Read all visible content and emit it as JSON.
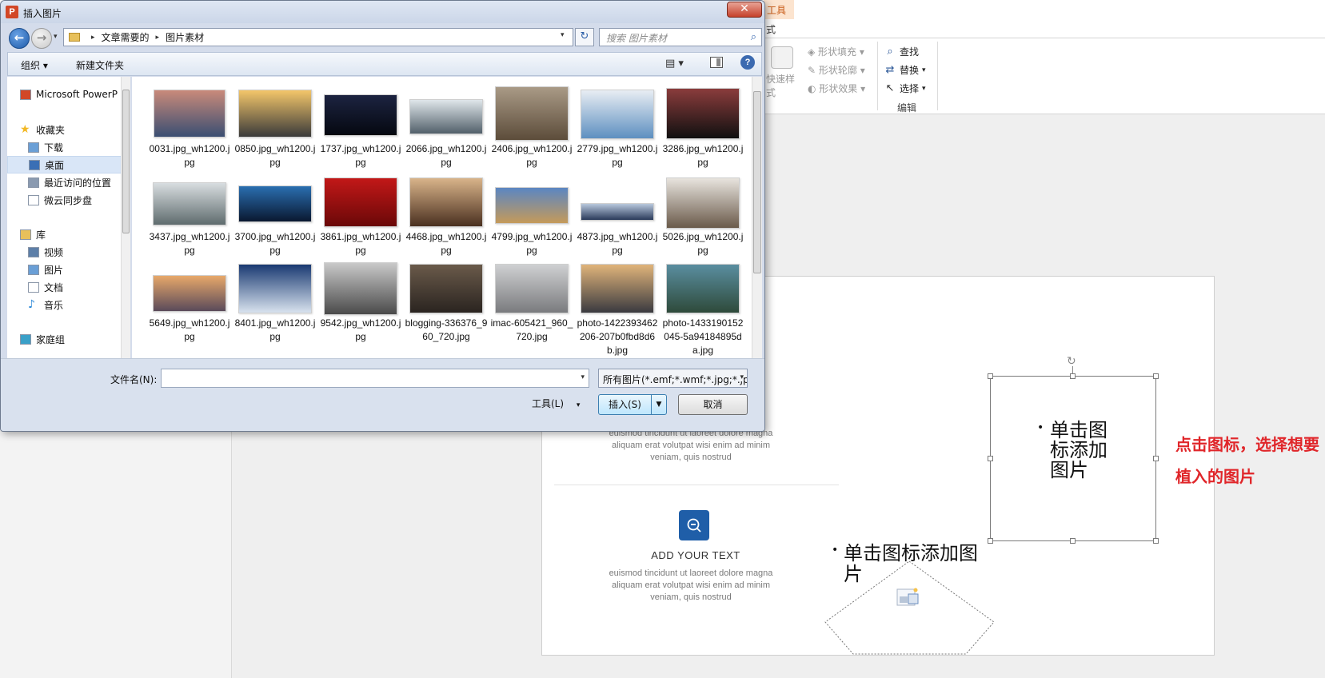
{
  "dialog": {
    "title": "插入图片",
    "close_glyph": "✕",
    "nav": {
      "back_glyph": "←",
      "forward_glyph": "→",
      "recent_glyph": "▾"
    },
    "address": {
      "crumbs": [
        "文章需要的",
        "图片素材"
      ],
      "separator": "▸",
      "dropdown_glyph": "▾"
    },
    "refresh_glyph": "↻",
    "search": {
      "placeholder": "搜索 图片素材",
      "icon": "search-icon"
    },
    "command_bar": {
      "organize": "组织 ▾",
      "new_folder": "新建文件夹",
      "view_glyph": "▤ ▾",
      "help": "?"
    },
    "nav_pane": {
      "items": [
        {
          "label": "Microsoft PowerP",
          "icon": "powerpoint-icon"
        },
        {
          "label": "收藏夹",
          "icon": "star-icon"
        },
        {
          "label": "下载",
          "icon": "download-icon"
        },
        {
          "label": "桌面",
          "icon": "desktop-icon",
          "selected": true
        },
        {
          "label": "最近访问的位置",
          "icon": "recent-places-icon"
        },
        {
          "label": "微云同步盘",
          "icon": "cloud-drive-icon"
        },
        {
          "label": "库",
          "icon": "library-icon"
        },
        {
          "label": "视频",
          "icon": "video-icon"
        },
        {
          "label": "图片",
          "icon": "pictures-icon"
        },
        {
          "label": "文档",
          "icon": "documents-icon"
        },
        {
          "label": "音乐",
          "icon": "music-icon"
        },
        {
          "label": "家庭组",
          "icon": "homegroup-icon"
        }
      ]
    },
    "files": [
      {
        "name": "0031.jpg_wh1200.jpg",
        "colors": [
          "#c98a7a",
          "#3a4e72"
        ]
      },
      {
        "name": "0850.jpg_wh1200.jpg",
        "colors": [
          "#f4c66a",
          "#3a3a3a"
        ]
      },
      {
        "name": "1737.jpg_wh1200.jpg",
        "colors": [
          "#1c2340",
          "#050810"
        ]
      },
      {
        "name": "2066.jpg_wh1200.jpg",
        "colors": [
          "#dfe6ea",
          "#52606a"
        ]
      },
      {
        "name": "2406.jpg_wh1200.jpg",
        "colors": [
          "#a99a86",
          "#5c4c3a"
        ]
      },
      {
        "name": "2779.jpg_wh1200.jpg",
        "colors": [
          "#e8edf3",
          "#5d8fc0"
        ]
      },
      {
        "name": "3286.jpg_wh1200.jpg",
        "colors": [
          "#8a3c3c",
          "#101010"
        ]
      },
      {
        "name": "3437.jpg_wh1200.jpg",
        "colors": [
          "#d8dde0",
          "#5f6c6e"
        ]
      },
      {
        "name": "3700.jpg_wh1200.jpg",
        "colors": [
          "#2a6fb0",
          "#0a1830"
        ]
      },
      {
        "name": "3861.jpg_wh1200.jpg",
        "colors": [
          "#c21818",
          "#6a0808"
        ]
      },
      {
        "name": "4468.jpg_wh1200.jpg",
        "colors": [
          "#d9b48a",
          "#4a3020"
        ]
      },
      {
        "name": "4799.jpg_wh1200.jpg",
        "colors": [
          "#5b86c2",
          "#c59a5a"
        ]
      },
      {
        "name": "4873.jpg_wh1200.jpg",
        "colors": [
          "#b7c7dc",
          "#2a3a5a"
        ]
      },
      {
        "name": "5026.jpg_wh1200.jpg",
        "colors": [
          "#e8e4de",
          "#6a5a4a"
        ]
      },
      {
        "name": "5649.jpg_wh1200.jpg",
        "colors": [
          "#e7a86a",
          "#5a4a5a"
        ]
      },
      {
        "name": "8401.jpg_wh1200.jpg",
        "colors": [
          "#1a3a72",
          "#d8e2ee"
        ]
      },
      {
        "name": "9542.jpg_wh1200.jpg",
        "colors": [
          "#c9c9c9",
          "#4a4a4a"
        ]
      },
      {
        "name": "blogging-336376_960_720.jpg",
        "colors": [
          "#6a5a4a",
          "#2a2420"
        ]
      },
      {
        "name": "imac-605421_960_720.jpg",
        "colors": [
          "#cfd0d2",
          "#7a7b7e"
        ]
      },
      {
        "name": "photo-1422393462206-207b0fbd8d6b.jpg",
        "colors": [
          "#e0b47a",
          "#3a3a40"
        ]
      },
      {
        "name": "photo-1433190152045-5a94184895da.jpg",
        "colors": [
          "#5a8ea0",
          "#2e4a3a"
        ]
      }
    ],
    "filename_label": "文件名(N):",
    "filename_value": "",
    "filetype": "所有图片(*.emf;*.wmf;*.jpg;*.jp",
    "tools": "工具(L)",
    "insert": "插入(S)",
    "cancel": "取消"
  },
  "ppt": {
    "tab_tools": "工具",
    "tab_format": "式",
    "ribbon": {
      "shape_fill": "形状填充 ▾",
      "shape_outline": "形状轮廓 ▾",
      "shape_effects": "形状效果 ▾",
      "quick_styles": "快速样式",
      "find": "查找",
      "replace": "替换",
      "select": "选择",
      "edit_group": "编辑"
    },
    "slide": {
      "body_text": "euismod tincidunt ut laoreet dolore magna aliquam erat volutpat wisi enim ad minim veniam, quis nostrud",
      "heading": "ADD YOUR TEXT",
      "placeholder_square": "单击图标添加图片",
      "placeholder_diamond": "单击图标添加图片"
    },
    "annotation": "点击图标，选择想要植入的图片"
  }
}
